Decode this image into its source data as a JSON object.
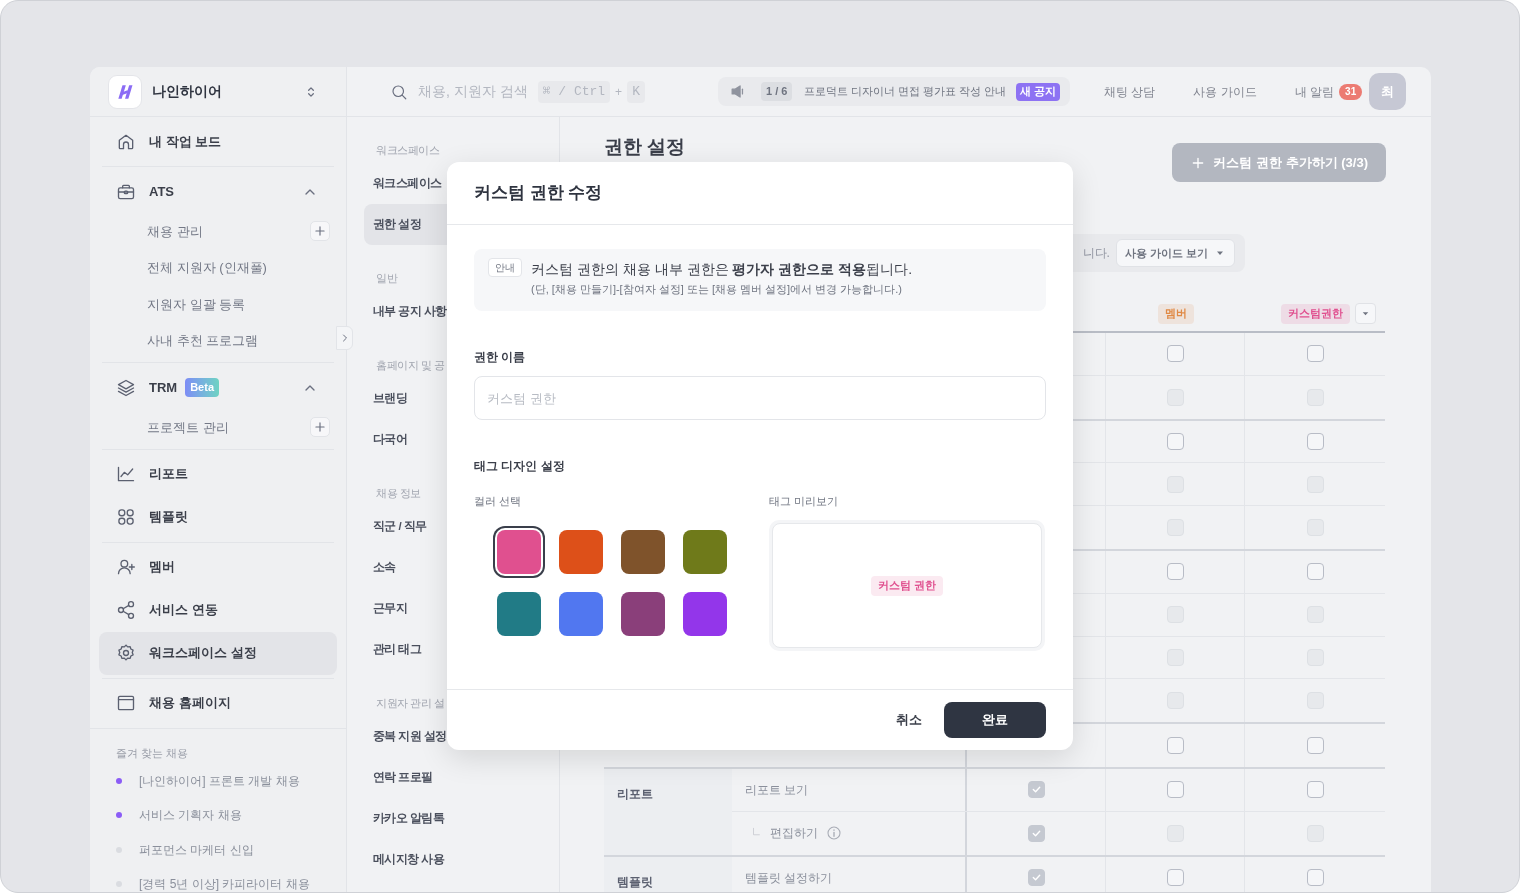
{
  "sidebar": {
    "workspace": "나인하이어",
    "blocks": [
      {
        "items": [
          {
            "kind": "item",
            "label": "내 작업 보드",
            "selected": false
          }
        ]
      },
      {
        "items": [
          {
            "kind": "section",
            "label": "ATS",
            "expanded": true
          },
          {
            "kind": "sub",
            "label": "채용 관리",
            "add": true
          },
          {
            "kind": "sub",
            "label": "전체 지원자 (인재풀)",
            "add": false
          },
          {
            "kind": "sub",
            "label": "지원자 일괄 등록",
            "add": false
          },
          {
            "kind": "sub",
            "label": "사내 추천 프로그램",
            "add": false
          }
        ]
      },
      {
        "items": [
          {
            "kind": "section",
            "label": "TRM",
            "badge": "Beta",
            "expanded": true
          },
          {
            "kind": "sub",
            "label": "프로젝트 관리",
            "add": true
          }
        ]
      },
      {
        "items": [
          {
            "kind": "item",
            "label": "리포트",
            "selected": false
          },
          {
            "kind": "item",
            "label": "템플릿",
            "selected": false
          }
        ]
      },
      {
        "items": [
          {
            "kind": "item",
            "label": "멤버",
            "selected": false
          },
          {
            "kind": "item",
            "label": "서비스 연동",
            "selected": false
          },
          {
            "kind": "item",
            "label": "워크스페이스 설정",
            "selected": true
          }
        ]
      },
      {
        "items": [
          {
            "kind": "item",
            "label": "채용 홈페이지",
            "selected": false
          }
        ]
      }
    ],
    "favorites": {
      "title": "즐겨 찾는 채용",
      "items": [
        {
          "label": "[나인하이어] 프론트 개발 채용",
          "color": "#8b5cf6"
        },
        {
          "label": "서비스 기획자 채용",
          "color": "#8b5cf6"
        },
        {
          "label": "퍼포먼스 마케터 신입",
          "color": "#dadce1"
        },
        {
          "label": "[경력 5년 이상] 카피라이터 채용",
          "color": "#dadce1"
        }
      ]
    }
  },
  "header": {
    "search": {
      "placeholder": "채용, 지원자 검색",
      "shortcut": [
        "⌘ / Ctrl",
        "+",
        "K"
      ]
    },
    "notice": {
      "counter": "1 / 6",
      "text": "프로덕트 디자이너 면접 평가표 작성 안내",
      "badge": "새 공지"
    },
    "links": [
      {
        "label": "채팅 상담"
      },
      {
        "label": "사용 가이드"
      },
      {
        "label": "내 알림",
        "count": "31"
      }
    ],
    "avatar": "최"
  },
  "settings_menu": {
    "sections": [
      {
        "title": "워크스페이스",
        "items": [
          {
            "label": "워크스페이스",
            "selected": false
          },
          {
            "label": "권한 설정",
            "selected": true
          }
        ]
      },
      {
        "title": "일반",
        "items": [
          {
            "label": "내부 공지 사항",
            "selected": false
          }
        ]
      },
      {
        "title": "홈페이지 및 공",
        "items": [
          {
            "label": "브랜딩",
            "selected": false
          },
          {
            "label": "다국어",
            "selected": false
          }
        ]
      },
      {
        "title": "채용 정보",
        "items": [
          {
            "label": "직군 / 직무",
            "selected": false
          },
          {
            "label": "소속",
            "selected": false
          },
          {
            "label": "근무지",
            "selected": false
          },
          {
            "label": "관리 태그",
            "selected": false
          }
        ]
      },
      {
        "title": "지원자 관리 설",
        "items": [
          {
            "label": "중복 지원 설정",
            "selected": false
          },
          {
            "label": "연락 프로필",
            "selected": false
          },
          {
            "label": "카카오 알림톡",
            "selected": false
          },
          {
            "label": "메시지창 사용",
            "selected": false
          }
        ]
      }
    ]
  },
  "page": {
    "title": "권한 설정",
    "add_button": {
      "label": "커스텀 권한 추가하기 (3/3)",
      "disabled": true
    },
    "info_bar": {
      "text": "니다.",
      "guide_button": "사용 가이드 보기"
    },
    "columns": [
      {
        "label": "멤버",
        "color": "#e08a46"
      },
      {
        "label": "커스텀권한",
        "color": "#e0508f"
      }
    ],
    "table": {
      "groups": [
        {
          "rows": [
            {
              "member": {
                "checked": false,
                "disabled": false
              },
              "custom_role": {
                "checked": false,
                "disabled": false
              }
            },
            {
              "member": {
                "checked": false,
                "disabled": true
              },
              "custom_role": {
                "checked": false,
                "disabled": true
              }
            }
          ]
        },
        {
          "rows": [
            {
              "member": {
                "checked": false,
                "disabled": false
              },
              "custom_role": {
                "checked": false,
                "disabled": false
              }
            },
            {
              "member": {
                "checked": false,
                "disabled": true
              },
              "custom_role": {
                "checked": false,
                "disabled": true
              }
            },
            {
              "member": {
                "checked": false,
                "disabled": true
              },
              "custom_role": {
                "checked": false,
                "disabled": true
              }
            }
          ]
        },
        {
          "rows": [
            {
              "member": {
                "checked": false,
                "disabled": false
              },
              "custom_role": {
                "checked": false,
                "disabled": false
              }
            },
            {
              "member": {
                "checked": false,
                "disabled": true
              },
              "custom_role": {
                "checked": false,
                "disabled": true
              }
            },
            {
              "member": {
                "checked": false,
                "disabled": true
              },
              "custom_role": {
                "checked": false,
                "disabled": true
              }
            },
            {
              "member": {
                "checked": false,
                "disabled": true
              },
              "custom_role": {
                "checked": false,
                "disabled": true
              }
            }
          ]
        },
        {
          "rows": [
            {
              "member": {
                "checked": false,
                "disabled": false
              },
              "custom_role": {
                "checked": false,
                "disabled": false
              }
            }
          ]
        },
        {
          "name": "리포트",
          "rows": [
            {
              "kind": "item",
              "item": "리포트 보기",
              "column_3": {
                "checked": true,
                "disabled": true
              },
              "member": {
                "checked": false,
                "disabled": false
              },
              "custom_role": {
                "checked": false,
                "disabled": false
              }
            },
            {
              "kind": "sub",
              "item": "편집하기",
              "column_3": {
                "checked": true,
                "disabled": true
              },
              "member": {
                "checked": false,
                "disabled": true
              },
              "custom_role": {
                "checked": false,
                "disabled": true
              }
            }
          ]
        },
        {
          "name": "템플릿",
          "rows": [
            {
              "kind": "item",
              "item": "템플릿 설정하기",
              "column_3": {
                "checked": true,
                "disabled": true
              },
              "member": {
                "checked": false,
                "disabled": false
              },
              "custom_role": {
                "checked": false,
                "disabled": false
              }
            }
          ]
        }
      ]
    }
  },
  "dialog": {
    "title": "커스텀 권한 수정",
    "notice": {
      "badge": "안내",
      "text": "커스텀 권한의 채용 내부 권한은 **평가자 권한으로 적용**됩니다.",
      "note": "(단, [채용 만들기]-[참여자 설정] 또는 [채용 멤버 설정]에서 변경 가능합니다.)"
    },
    "name_field": {
      "label": "권한 이름",
      "placeholder": "커스텀 권한"
    },
    "tag_design": {
      "title": "태그 디자인 설정",
      "color_label": "컬러 선택",
      "colors": [
        {
          "color": "#e0508f",
          "selected": true
        },
        {
          "color": "#dd5019",
          "selected": false
        },
        {
          "color": "#7f532b",
          "selected": false
        },
        {
          "color": "#6f7a1a",
          "selected": false
        },
        {
          "color": "#217b86",
          "selected": false
        },
        {
          "color": "#5177f0",
          "selected": false
        },
        {
          "color": "#8a3f7a",
          "selected": false
        },
        {
          "color": "#9336ea",
          "selected": false
        }
      ],
      "preview_label": "태그 미리보기",
      "preview_tag": "커스텀 권한"
    },
    "buttons": {
      "cancel": "취소",
      "confirm": "완료"
    }
  }
}
